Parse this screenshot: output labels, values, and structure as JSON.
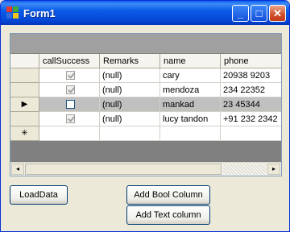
{
  "window": {
    "title": "Form1",
    "buttons": {
      "minimize": "_",
      "maximize": "□",
      "close": "✕"
    }
  },
  "grid": {
    "columns": [
      "callSuccess",
      "Remarks",
      "name",
      "phone"
    ],
    "rows": [
      {
        "callSuccess": true,
        "remarks": "(null)",
        "name": "cary",
        "phone": "20938 9203"
      },
      {
        "callSuccess": true,
        "remarks": "(null)",
        "name": "mendoza",
        "phone": "234 22352"
      },
      {
        "callSuccess": false,
        "remarks": "(null)",
        "name": "mankad",
        "phone": "23 45344"
      },
      {
        "callSuccess": true,
        "remarks": "(null)",
        "name": "lucy tandon",
        "phone": "+91 232 2342"
      }
    ],
    "current_row_marker": "▶",
    "new_row_marker": "✳",
    "scroll_left": "◂",
    "scroll_right": "▸"
  },
  "buttons": {
    "load_data": "LoadData",
    "add_bool_column": "Add Bool Column",
    "add_text_column": "Add Text column"
  },
  "colors": {
    "titlebar": "#0A5CE8",
    "grid_background": "#808080",
    "selected_row": "#C0C0C0"
  }
}
